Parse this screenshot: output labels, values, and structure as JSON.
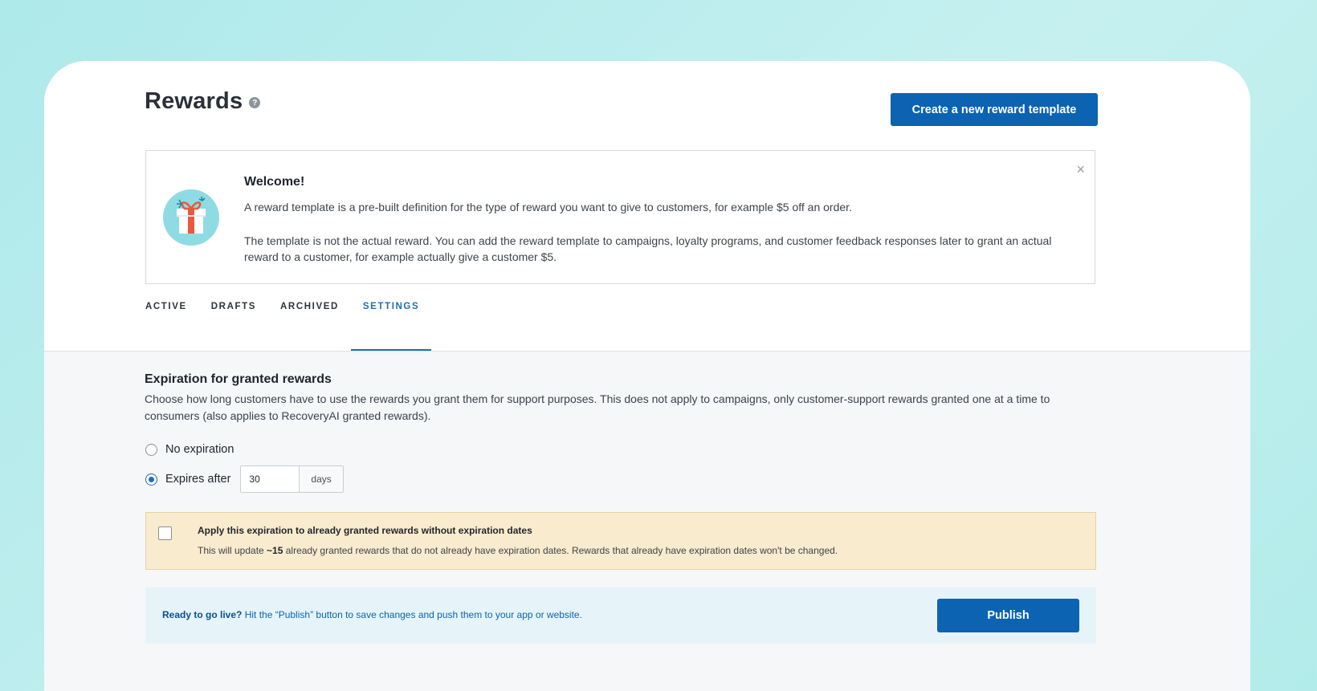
{
  "header": {
    "title": "Rewards",
    "help_glyph": "?",
    "create_button": "Create a new reward template"
  },
  "welcome": {
    "title": "Welcome!",
    "paragraph1": "A reward template is a pre-built definition for the type of reward you want to give to customers, for example $5 off an order.",
    "paragraph2": "The template is not the actual reward. You can add the reward template to campaigns, loyalty programs, and customer feedback responses later to grant an actual reward to a customer, for example actually give a customer $5.",
    "close_glyph": "×",
    "icon": "gift-icon"
  },
  "tabs": [
    {
      "label": "ACTIVE",
      "active": false
    },
    {
      "label": "DRAFTS",
      "active": false
    },
    {
      "label": "ARCHIVED",
      "active": false
    },
    {
      "label": "SETTINGS",
      "active": true
    }
  ],
  "expiration": {
    "title": "Expiration for granted rewards",
    "description": "Choose how long customers have to use the rewards you grant them for support purposes. This does not apply to campaigns, only customer-support rewards granted one at a time to consumers (also applies to RecoveryAI granted rewards).",
    "options": [
      {
        "label": "No expiration",
        "selected": false
      },
      {
        "label": "Expires after",
        "selected": true
      }
    ],
    "days_value": "30",
    "days_unit": "days"
  },
  "notice": {
    "checkbox_checked": false,
    "title": "Apply this expiration to already granted rewards without expiration dates",
    "text_prefix": "This will update ",
    "count": "~15",
    "text_suffix": " already granted rewards that do not already have expiration dates. Rewards that already have expiration dates won't be changed."
  },
  "publish_bar": {
    "lead": "Ready to go live?",
    "text": " Hit the “Publish” button to save changes and push them to your app or website.",
    "button": "Publish"
  },
  "colors": {
    "primary": "#0b63b1",
    "tab_active": "#1d6fb8",
    "notice_bg": "#f9ebcd",
    "publish_bg": "#e6f4fa",
    "background": "#b7ecec"
  }
}
